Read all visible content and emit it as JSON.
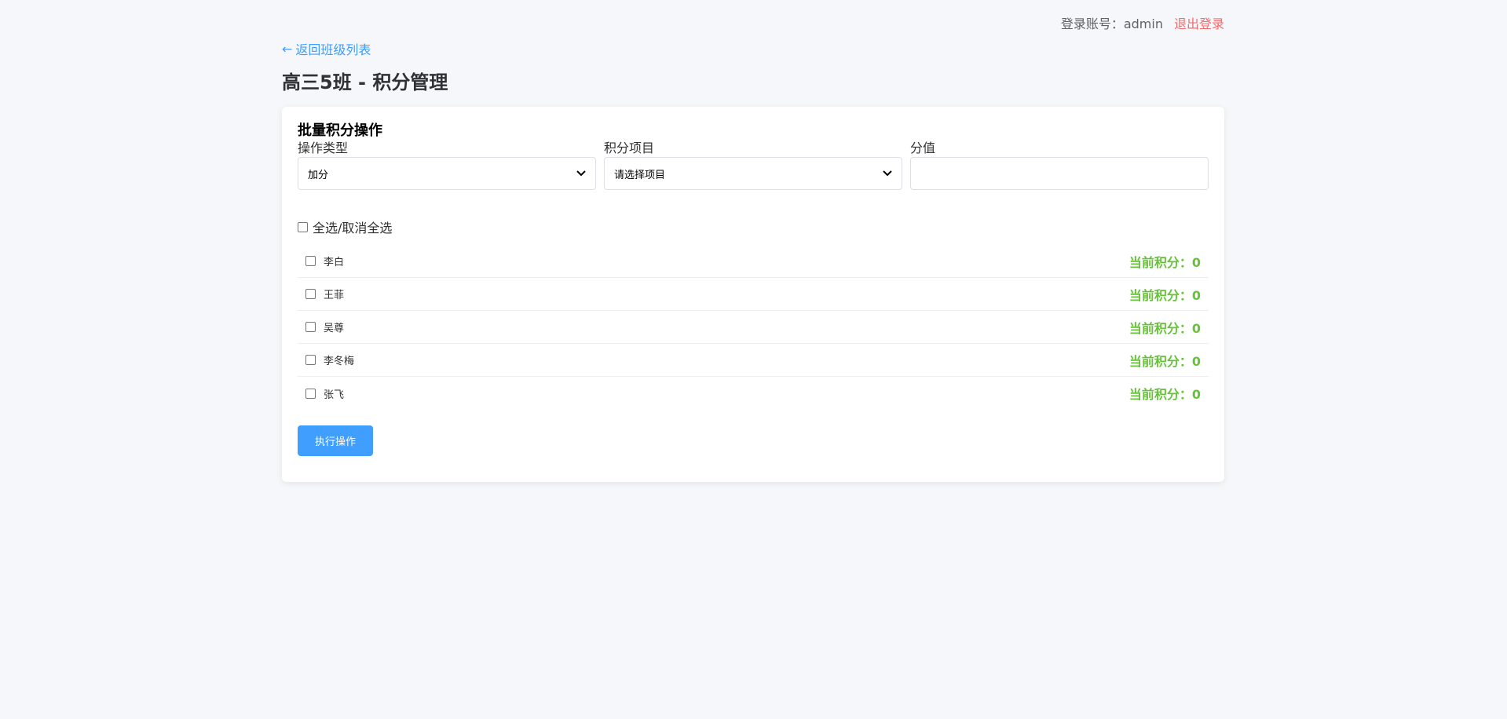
{
  "header": {
    "account_label": "登录账号：admin",
    "logout_label": "退出登录"
  },
  "nav": {
    "back_arrow": "←",
    "back_label": "返回班级列表"
  },
  "page": {
    "title": "高三5班 - 积分管理"
  },
  "batch": {
    "title": "批量积分操作",
    "operation_type_label": "操作类型",
    "operation_type_value": "加分",
    "item_label": "积分项目",
    "item_value": "请选择项目",
    "score_label": "分值",
    "score_value": "",
    "select_all_label": "全选/取消全选",
    "submit_label": "执行操作"
  },
  "students": [
    {
      "name": "李白",
      "score": "当前积分：0"
    },
    {
      "name": "王菲",
      "score": "当前积分：0"
    },
    {
      "name": "吴尊",
      "score": "当前积分：0"
    },
    {
      "name": "李冬梅",
      "score": "当前积分：0"
    },
    {
      "name": "张飞",
      "score": "当前积分：0"
    }
  ],
  "colors": {
    "primary": "#409eff",
    "danger": "#f56c6c",
    "success": "#67c23a",
    "background": "#f5f7fa"
  },
  "icons": {
    "select_chevron": "chevron-down-icon"
  }
}
